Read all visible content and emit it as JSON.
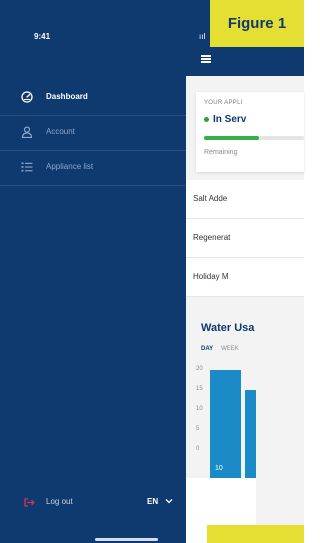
{
  "status_bar": {
    "time": "9:41",
    "signal": "ııl"
  },
  "figure_badge": "Figure 1",
  "drawer": {
    "items": [
      {
        "label": "Dashboard",
        "icon": "dashboard-gauge-icon",
        "active": true
      },
      {
        "label": "Account",
        "icon": "user-icon",
        "active": false
      },
      {
        "label": "Appliance list",
        "icon": "list-icon",
        "active": false
      }
    ],
    "logout_label": "Log out",
    "language": "EN"
  },
  "main": {
    "card": {
      "label": "YOUR APPLI",
      "status": "In Serv",
      "remaining_label": "Remaining",
      "progress_fraction": 0.55
    },
    "rows": [
      "Salt Adde",
      "Regenerat",
      "Holiday M"
    ],
    "usage": {
      "title": "Water Usa",
      "tabs": [
        "DAY",
        "WEEK"
      ],
      "y_ticks": [
        "20",
        "15",
        "10",
        "5",
        "0"
      ],
      "bar_label": "10"
    }
  },
  "colors": {
    "drawer_bg": "#0e3a70",
    "accent_green": "#34b04a",
    "bar_blue": "#1a8bc7",
    "badge_yellow": "#e5df33",
    "logout_red": "#e0334b"
  }
}
